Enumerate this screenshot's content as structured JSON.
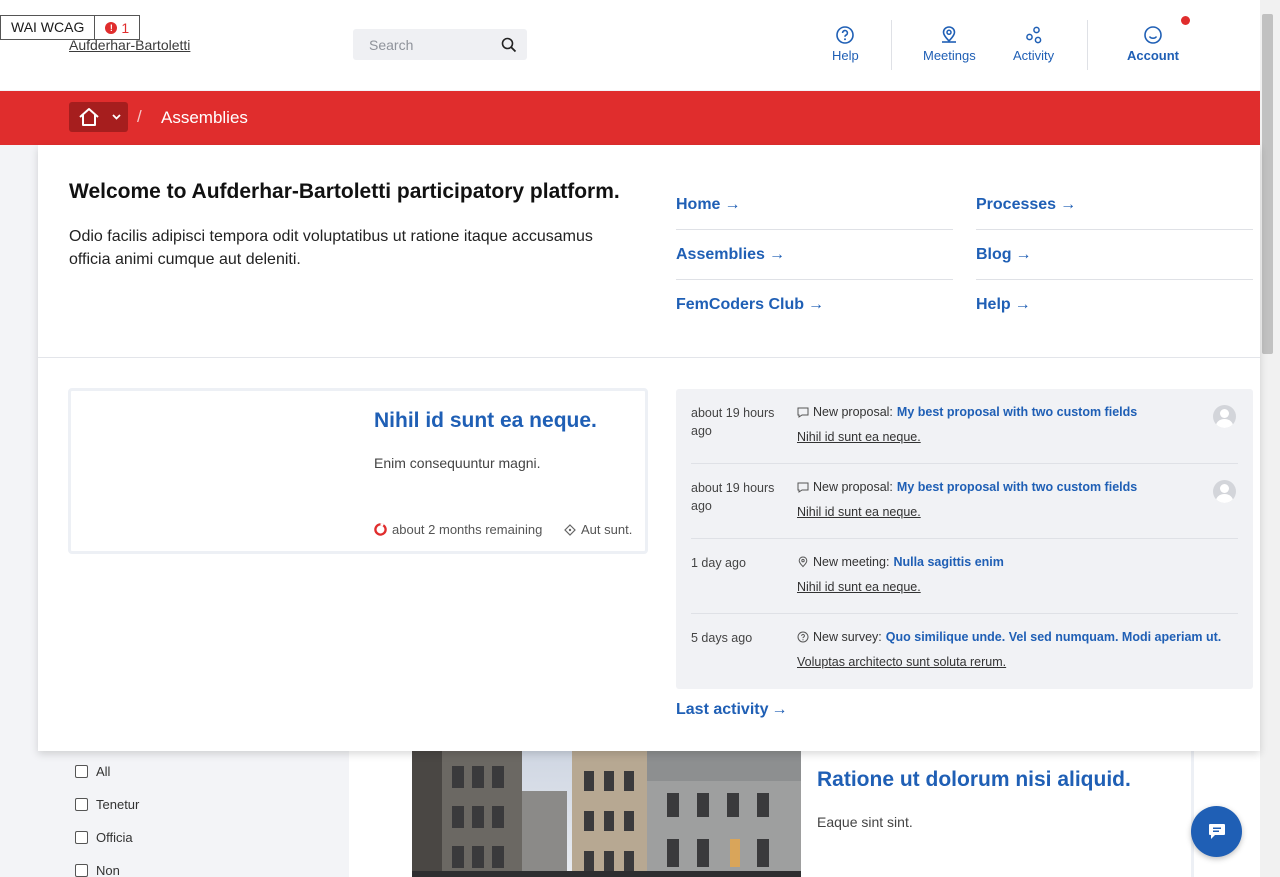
{
  "wcag": {
    "label": "WAI WCAG",
    "count": "1"
  },
  "header": {
    "org_name": "Aufderhar-Bartoletti",
    "search_placeholder": "Search",
    "nav": [
      {
        "label": "Help",
        "icon": "help-icon"
      },
      {
        "label": "Meetings",
        "icon": "meetings-icon"
      },
      {
        "label": "Activity",
        "icon": "activity-icon"
      },
      {
        "label": "Account",
        "icon": "account-icon"
      }
    ]
  },
  "breadcrumb": {
    "separator": "/",
    "current": "Assemblies"
  },
  "welcome": {
    "title": "Welcome to Aufderhar-Bartoletti participatory platform.",
    "description": "Odio facilis adipisci tempora odit voluptatibus ut ratione itaque accusamus officia animi cumque aut deleniti."
  },
  "quick_links": [
    "Home",
    "Processes",
    "Assemblies",
    "Blog",
    "FemCoders Club",
    "Help"
  ],
  "featured_card": {
    "title": "Nihil id sunt ea neque.",
    "description": "Enim consequuntur magni.",
    "remaining": "about 2 months remaining",
    "tag": "Aut sunt."
  },
  "activity": [
    {
      "time": "about 19 hours ago",
      "type": "New proposal:",
      "title": "My best proposal with two custom fields",
      "space": "Nihil id sunt ea neque.",
      "avatar": true
    },
    {
      "time": "about 19 hours ago",
      "type": "New proposal:",
      "title": "My best proposal with two custom fields",
      "space": "Nihil id sunt ea neque.",
      "avatar": true
    },
    {
      "time": "1 day ago",
      "type": "New meeting:",
      "title": "Nulla sagittis enim",
      "space": "Nihil id sunt ea neque.",
      "avatar": false
    },
    {
      "time": "5 days ago",
      "type": "New survey:",
      "title": "Quo similique unde. Vel sed numquam. Modi aperiam ut.",
      "space": "Voluptas architecto sunt soluta rerum.",
      "avatar": false
    }
  ],
  "last_activity_label": "Last activity",
  "filters": [
    "All",
    "Tenetur",
    "Officia",
    "Non"
  ],
  "background_card": {
    "title": "Ratione ut dolorum nisi aliquid.",
    "description": "Eaque sint sint."
  },
  "colors": {
    "primary": "#1f5fb5",
    "brand_red": "#e02d2d",
    "dark_red": "#a61e1e"
  }
}
